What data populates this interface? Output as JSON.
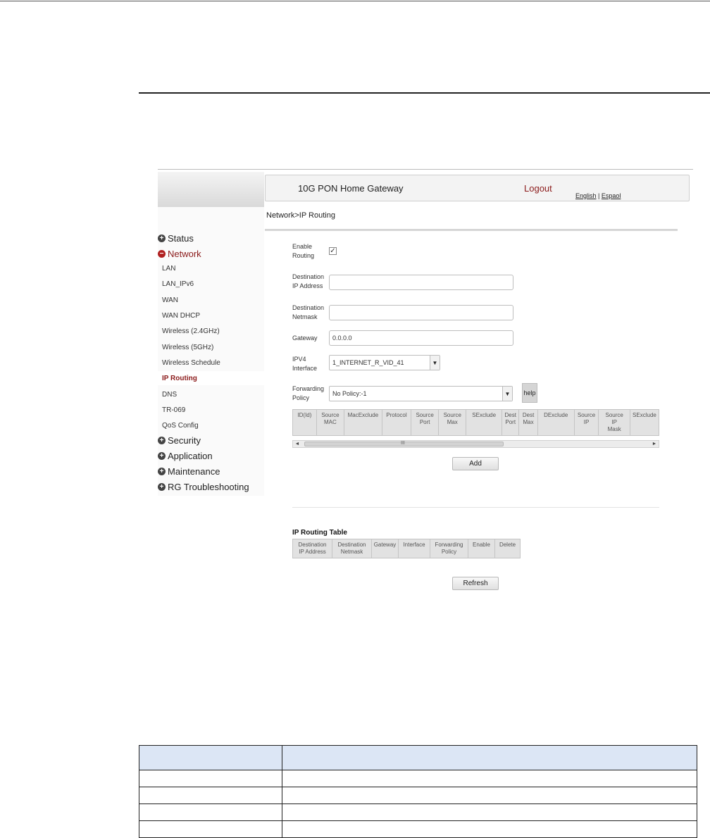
{
  "app": {
    "title": "10G PON Home Gateway",
    "logout_label": "Logout",
    "lang_english": "English",
    "lang_separator": "|",
    "lang_spanish": "Espaol"
  },
  "breadcrumb": "Network>IP Routing",
  "sidebar": {
    "groups": [
      {
        "label": "Status",
        "expanded": false
      },
      {
        "label": "Network",
        "expanded": true
      },
      {
        "label": "Security",
        "expanded": false
      },
      {
        "label": "Application",
        "expanded": false
      },
      {
        "label": "Maintenance",
        "expanded": false
      },
      {
        "label": "RG Troubleshooting",
        "expanded": false
      }
    ],
    "network_items": [
      "LAN",
      "LAN_IPv6",
      "WAN",
      "WAN DHCP",
      "Wireless (2.4GHz)",
      "Wireless (5GHz)",
      "Wireless Schedule",
      "IP Routing",
      "DNS",
      "TR-069",
      "QoS Config"
    ],
    "current_item": "IP Routing"
  },
  "form": {
    "enable_routing": {
      "label_line1": "Enable",
      "label_line2": "Routing",
      "checked": true,
      "check_glyph": "✓"
    },
    "dest_ip": {
      "label_line1": "Destination",
      "label_line2": "IP Address",
      "value": ""
    },
    "dest_netmask": {
      "label_line1": "Destination",
      "label_line2": "Netmask",
      "value": ""
    },
    "gateway": {
      "label": "Gateway",
      "value": "0.0.0.0"
    },
    "ipv4_interface": {
      "label_line1": "IPV4",
      "label_line2": "Interface",
      "value": "1_INTERNET_R_VID_41"
    },
    "forwarding_policy": {
      "label_line1": "Forwarding",
      "label_line2": "Policy",
      "value": "No Policy:-1"
    },
    "help_label": "help"
  },
  "policy_table": {
    "columns": [
      [
        "ID(Id)"
      ],
      [
        "Source",
        "MAC"
      ],
      [
        "MacExclude"
      ],
      [
        "Protocol"
      ],
      [
        "Source",
        "Port"
      ],
      [
        "Source",
        "Max"
      ],
      [
        "SExclude"
      ],
      [
        "Dest",
        "Port"
      ],
      [
        "Dest",
        "Max"
      ],
      [
        "DExclude"
      ],
      [
        "Source",
        "IP"
      ],
      [
        "Source",
        "IP",
        "Mask"
      ],
      [
        "SExclude"
      ]
    ],
    "scroll_grip": "III",
    "scroll_left": "◄",
    "scroll_right": "►"
  },
  "add_label": "Add",
  "routing_table": {
    "title": "IP Routing Table",
    "columns": [
      [
        "Destination",
        "IP Address"
      ],
      [
        "Destination",
        "Netmask"
      ],
      [
        "Gateway"
      ],
      [
        "Interface"
      ],
      [
        "Forwarding",
        "Policy"
      ],
      [
        "Enable"
      ],
      [
        "Delete"
      ]
    ]
  },
  "refresh_label": "Refresh",
  "doc_table": {
    "rows": 4
  }
}
